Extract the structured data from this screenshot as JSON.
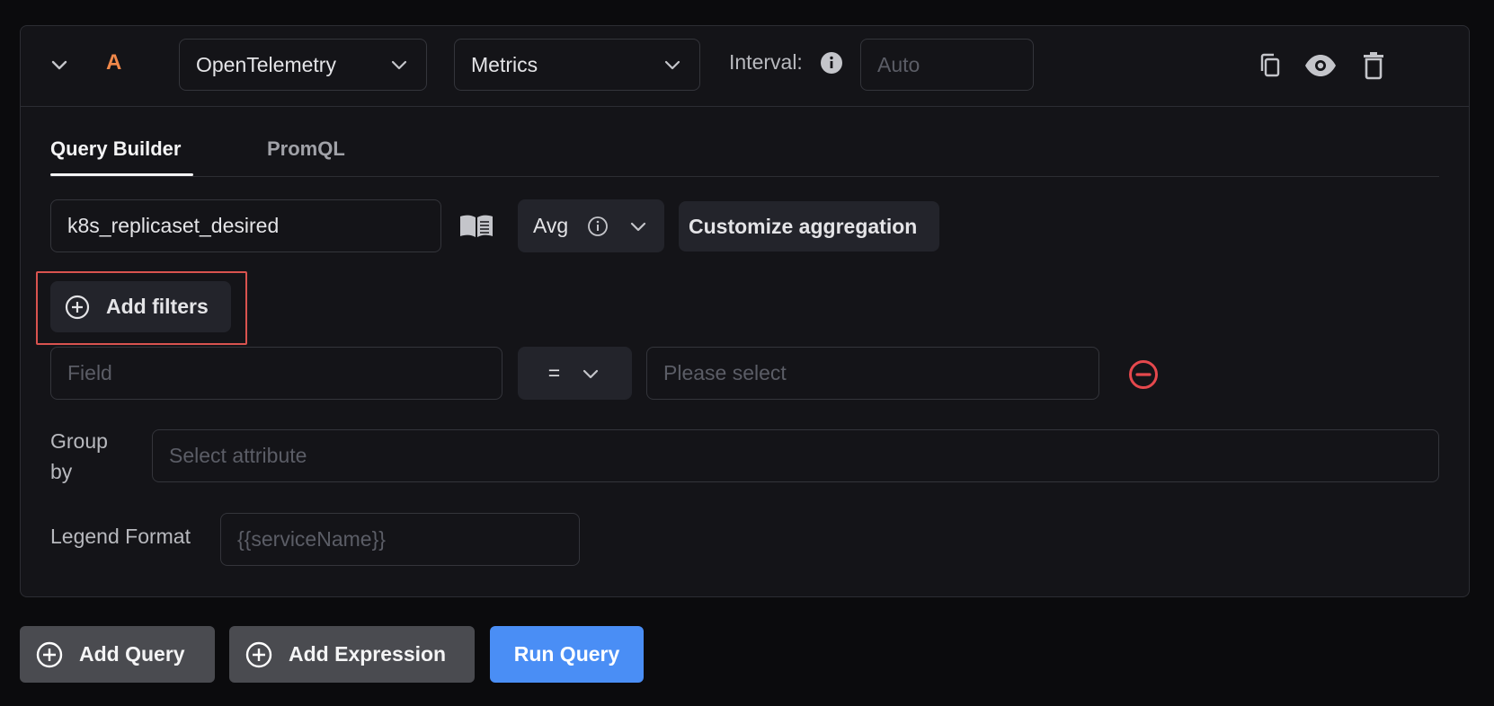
{
  "query": {
    "letter": "A",
    "data_source": "OpenTelemetry",
    "data_type": "Metrics",
    "interval_label": "Interval:",
    "interval_placeholder": "Auto"
  },
  "tabs": [
    {
      "label": "Query Builder",
      "active": true
    },
    {
      "label": "PromQL",
      "active": false
    }
  ],
  "builder": {
    "metric_value": "k8s_replicaset_desired",
    "aggregation": "Avg",
    "customize_label": "Customize aggregation",
    "add_filters_label": "Add filters",
    "filter": {
      "field_placeholder": "Field",
      "operator": "=",
      "value_placeholder": "Please select"
    },
    "group_by_label_line1": "Group",
    "group_by_label_line2": "by",
    "group_by_placeholder": "Select attribute",
    "legend_label": "Legend Format",
    "legend_placeholder": "{{serviceName}}"
  },
  "footer": {
    "add_query": "Add Query",
    "add_expression": "Add Expression",
    "run_query": "Run Query"
  },
  "colors": {
    "accent_orange": "#f0884a",
    "primary_blue": "#4a8ef5",
    "danger_red": "#e5484d",
    "highlight_red": "#d9534f"
  },
  "icons": [
    "chevron-down-icon",
    "info-icon",
    "copy-icon",
    "eye-icon",
    "trash-icon",
    "book-icon",
    "plus-circle-icon",
    "minus-circle-icon"
  ]
}
